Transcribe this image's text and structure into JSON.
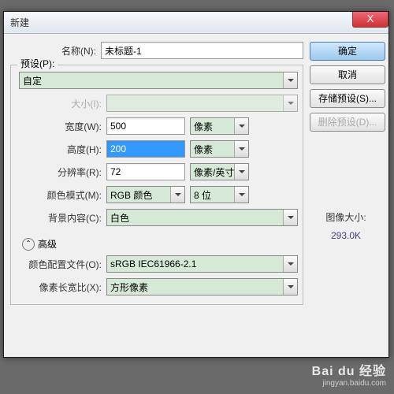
{
  "window": {
    "title": "新建",
    "close": "X"
  },
  "labels": {
    "name": "名称(N):",
    "preset": "预设(P):",
    "size": "大小(I):",
    "width": "宽度(W):",
    "height": "高度(H):",
    "resolution": "分辨率(R):",
    "colorMode": "颜色模式(M):",
    "bgContent": "背景内容(C):",
    "advanced": "高级",
    "colorProfile": "颜色配置文件(O):",
    "pixelAspect": "像素长宽比(X):",
    "imageSizeLabel": "图像大小:"
  },
  "values": {
    "name": "未标题-1",
    "preset": "自定",
    "size": "",
    "width": "500",
    "height": "200",
    "resolution": "72",
    "unitPixel": "像素",
    "unitPPI": "像素/英寸",
    "colorMode": "RGB 颜色",
    "bitDepth": "8 位",
    "bgContent": "白色",
    "colorProfile": "sRGB IEC61966-2.1",
    "pixelAspect": "方形像素",
    "imageSize": "293.0K",
    "advToggle": "ˆ"
  },
  "buttons": {
    "ok": "确定",
    "cancel": "取消",
    "savePreset": "存储预设(S)...",
    "deletePreset": "删除预设(D)..."
  },
  "watermark": {
    "brand": "Bai du 经验",
    "url": "jingyan.baidu.com"
  }
}
